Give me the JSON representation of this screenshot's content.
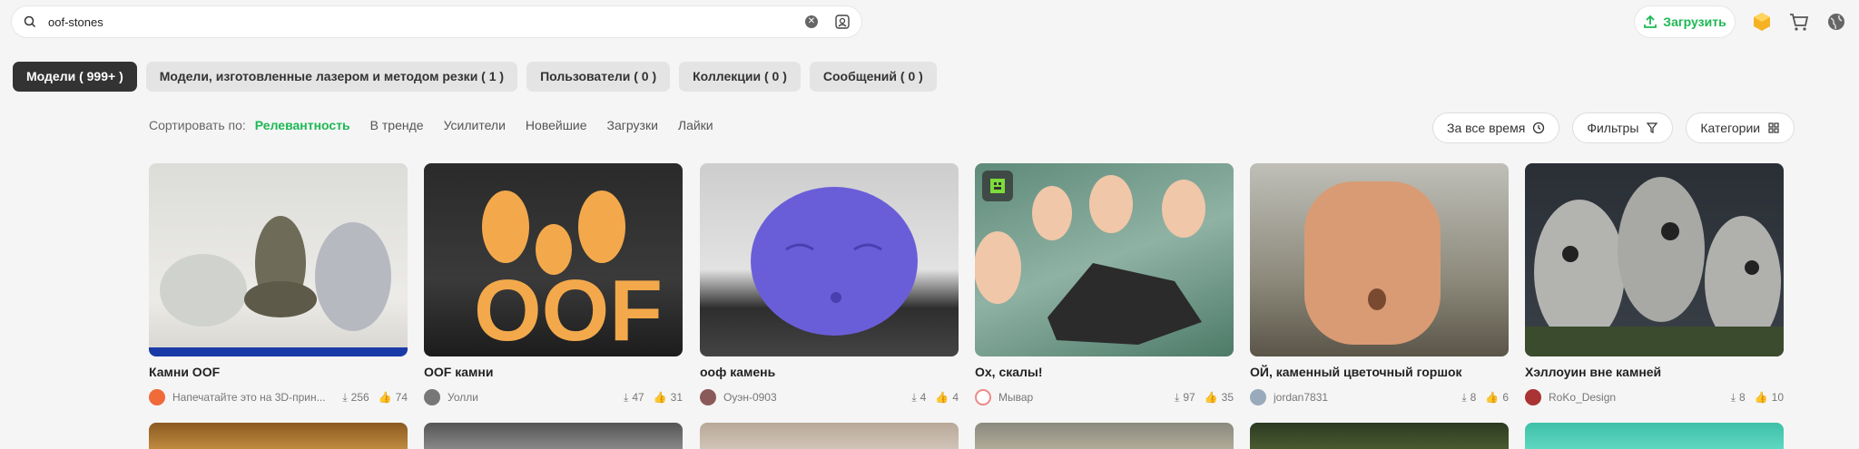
{
  "header": {
    "search_value": "oof-stones",
    "upload_label": "Загрузить"
  },
  "tabs": [
    {
      "label": "Модели ( 999+ )",
      "active": true
    },
    {
      "label": "Модели, изготовленные лазером и методом резки ( 1 )"
    },
    {
      "label": "Пользователи ( 0 )"
    },
    {
      "label": "Коллекции ( 0 )"
    },
    {
      "label": "Сообщений ( 0 )"
    }
  ],
  "sort": {
    "label": "Сортировать по:",
    "options": [
      "Релевантность",
      "В тренде",
      "Усилители",
      "Новейшие",
      "Загрузки",
      "Лайки"
    ],
    "active": "Релевантность"
  },
  "filters": {
    "time": "За все время",
    "filters": "Фильтры",
    "categories": "Категории"
  },
  "cards": [
    {
      "title": "Камни OOF",
      "author": "Напечатайте это на 3D-прин...",
      "downloads": "256",
      "likes": "74"
    },
    {
      "title": "OOF камни",
      "author": "Уолли",
      "downloads": "47",
      "likes": "31"
    },
    {
      "title": "ооф камень",
      "author": "Оуэн-0903",
      "downloads": "4",
      "likes": "4"
    },
    {
      "title": "Ох, скалы!",
      "author": "Мывар",
      "downloads": "97",
      "likes": "35"
    },
    {
      "title": "ОЙ, каменный цветочный горшок",
      "author": "jordan7831",
      "downloads": "8",
      "likes": "6"
    },
    {
      "title": "Хэллоуин вне камней",
      "author": "RoKo_Design",
      "downloads": "8",
      "likes": "10"
    }
  ],
  "colors": {
    "accent": "#1db954",
    "active_tab": "#333333"
  }
}
